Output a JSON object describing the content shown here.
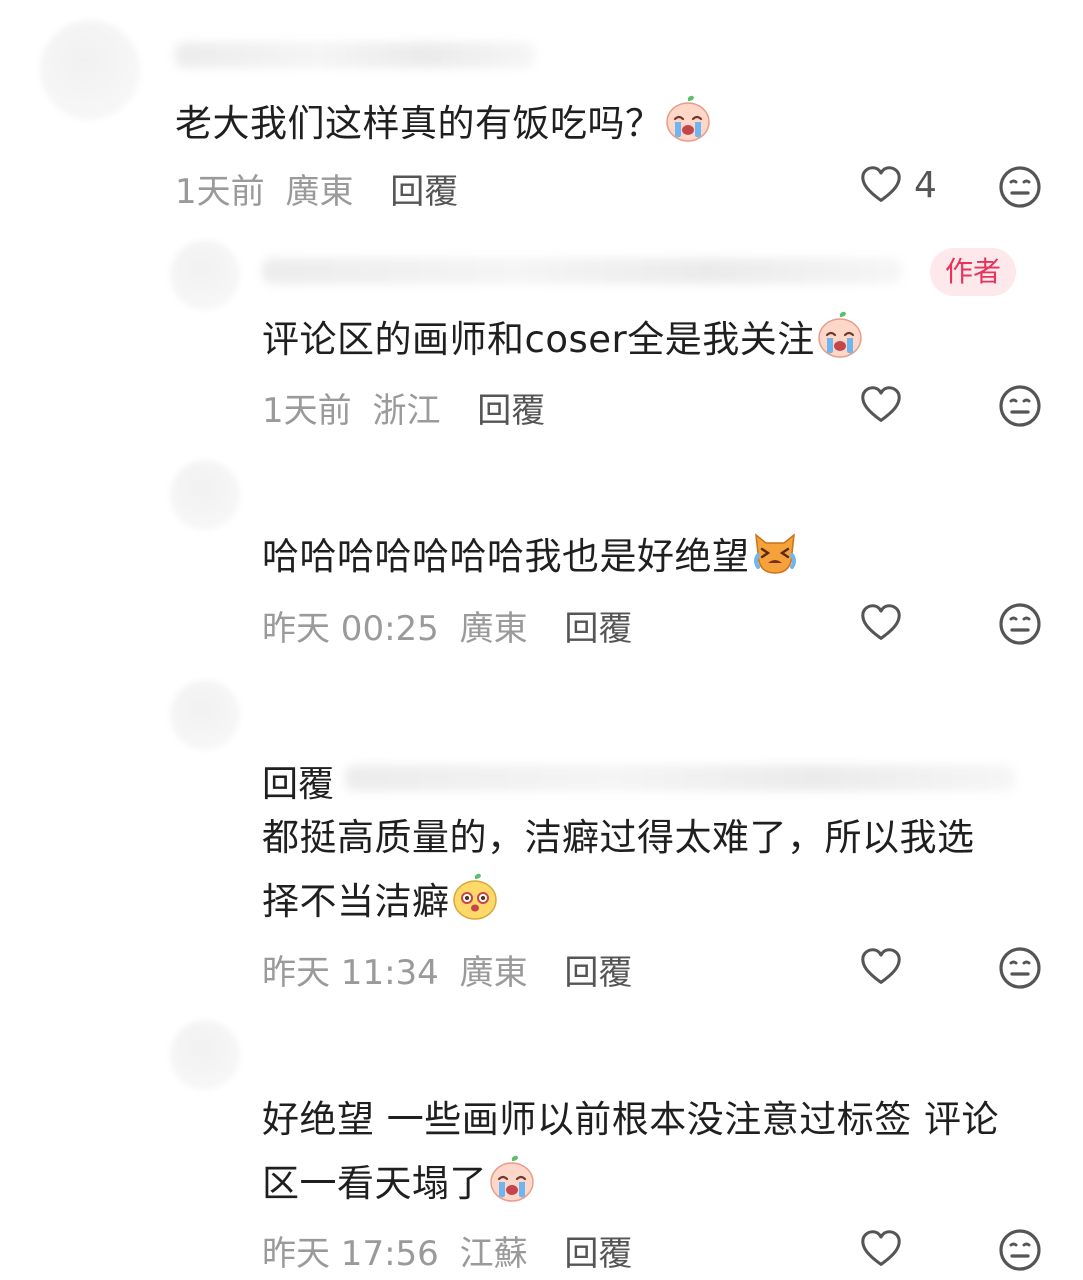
{
  "comments": [
    {
      "text": "老大我们这样真的有饭吃吗？",
      "time": "1天前",
      "location": "廣東",
      "reply_label": "回覆",
      "likes": "4",
      "emoji": "crying-face-icon"
    },
    {
      "text": "评论区的画师和coser全是我关注",
      "time": "1天前",
      "location": "浙江",
      "reply_label": "回覆",
      "author_badge": "作者",
      "emoji": "sobbing-face-icon"
    },
    {
      "text": "哈哈哈哈哈哈哈我也是好绝望",
      "time": "昨天 00:25",
      "location": "廣東",
      "reply_label": "回覆",
      "emoji": "crying-cat-icon"
    },
    {
      "reply_prefix": "回覆",
      "line1": "都挺高质量的，洁癖过得太难了，所以我选",
      "line2": "择不当洁癖",
      "time": "昨天 11:34",
      "location": "廣東",
      "reply_label": "回覆",
      "emoji": "surprised-face-icon"
    },
    {
      "line1": "好绝望 一些画师以前根本没注意过标签 评论",
      "line2": "区一看天塌了",
      "time": "昨天 17:56",
      "location": "江蘇",
      "reply_label": "回覆",
      "emoji": "crying-face-icon"
    }
  ],
  "colors": {
    "meta_gray": "#9a9a9a",
    "icon_gray": "#555555",
    "author_badge_bg": "#fde8ec",
    "author_badge_text": "#e8335a"
  }
}
